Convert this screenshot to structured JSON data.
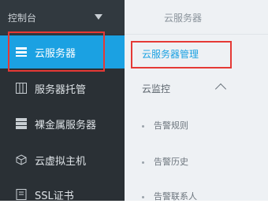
{
  "sidebar": {
    "header": "控制台",
    "items": [
      {
        "label": "云服务器",
        "icon": "server-list-icon"
      },
      {
        "label": "服务器托管",
        "icon": "server-rack-icon"
      },
      {
        "label": "裸金属服务器",
        "icon": "bare-metal-icon"
      },
      {
        "label": "云虚拟主机",
        "icon": "cube-icon"
      },
      {
        "label": "SSL证书",
        "icon": "certificate-icon"
      }
    ]
  },
  "subnav": {
    "title": "云服务器",
    "link": "云服务器管理",
    "group": "云监控",
    "items": [
      "告警规则",
      "告警历史",
      "告警联系人"
    ]
  },
  "colors": {
    "accent": "#1ba1e2",
    "highlight": "#e53935",
    "sidebar": "#2a3035"
  }
}
